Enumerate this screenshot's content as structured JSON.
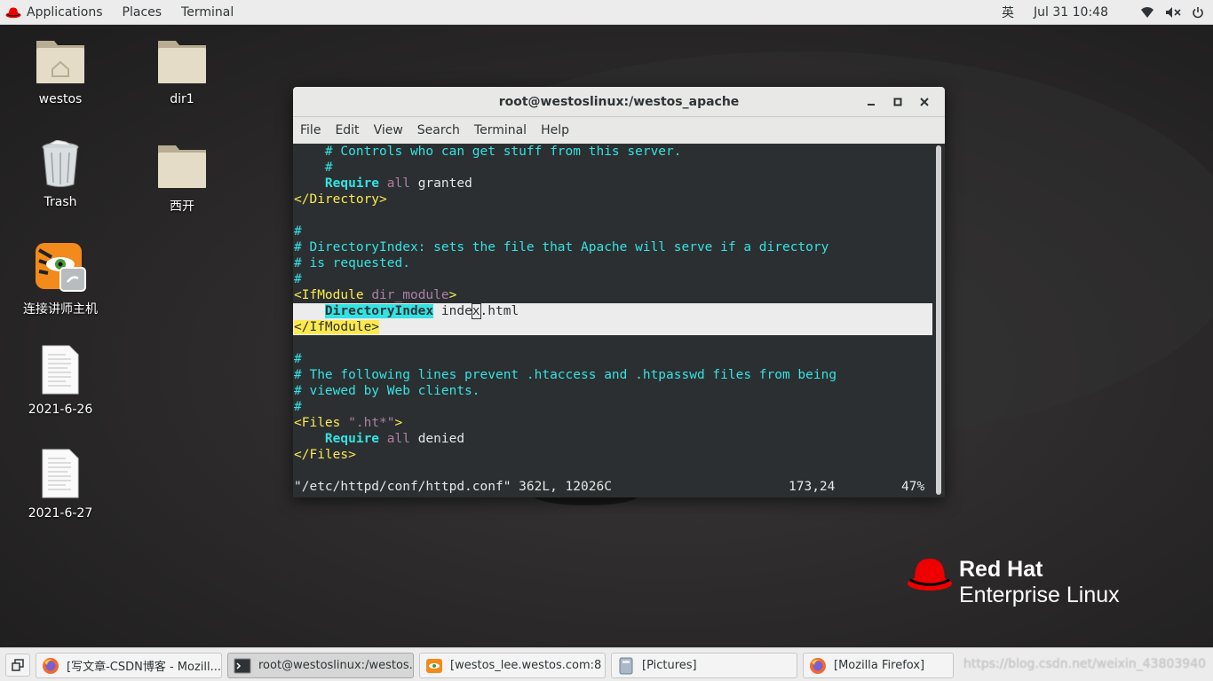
{
  "topbar": {
    "applications": "Applications",
    "places": "Places",
    "terminal": "Terminal",
    "input_method": "英",
    "clock": "Jul 31  10:48"
  },
  "desktop_icons": [
    {
      "label": "westos",
      "icon": "home-folder-icon"
    },
    {
      "label": "dir1",
      "icon": "folder-icon"
    },
    {
      "label": "Trash",
      "icon": "trash-icon"
    },
    {
      "label": "西开",
      "icon": "folder-icon"
    },
    {
      "label": "连接讲师主机",
      "icon": "remote-viewer-icon"
    },
    {
      "label": "2021-6-26",
      "icon": "document-icon"
    },
    {
      "label": "2021-6-27",
      "icon": "document-icon"
    }
  ],
  "terminal": {
    "title": "root@westoslinux:/westos_apache",
    "menu": [
      "File",
      "Edit",
      "View",
      "Search",
      "Terminal",
      "Help"
    ],
    "lines": {
      "l1": "    # Controls who can get stuff from this server.",
      "l2": "    #",
      "l3_kw": "Require",
      "l3_mid": "all",
      "l3_end": "granted",
      "l4": "</Directory>",
      "l6": "#",
      "l7": "# DirectoryIndex: sets the file that Apache will serve if a directory",
      "l8": "# is requested.",
      "l9": "#",
      "l10_tag": "<IfModule",
      "l10_attr": "dir_module",
      "l10_close": ">",
      "l11_kw": "DirectoryIndex",
      "l11_a": "inde",
      "l11_cursor": "x",
      "l11_b": ".html",
      "l12": "</IfModule>",
      "l14": "#",
      "l15": "# The following lines prevent .htaccess and .htpasswd files from being",
      "l16": "# viewed by Web clients.",
      "l17": "#",
      "l18_tag": "<Files",
      "l18_attr": "\".ht*\"",
      "l18_close": ">",
      "l19_kw": "Require",
      "l19_mid": "all",
      "l19_end": "denied",
      "l20": "</Files>"
    },
    "status_file": "\"/etc/httpd/conf/httpd.conf\" 362L, 12026C",
    "status_pos": "173,24",
    "status_pct": "47%"
  },
  "logo": {
    "line1": "Red Hat",
    "line2": "Enterprise Linux"
  },
  "taskbar": {
    "items": [
      {
        "label": "[写文章-CSDN博客 - Mozill...",
        "icon": "firefox-icon"
      },
      {
        "label": "root@westoslinux:/westos...",
        "icon": "terminal-icon"
      },
      {
        "label": "[westos_lee.westos.com:8 ...",
        "icon": "remote-viewer-icon"
      },
      {
        "label": "[Pictures]",
        "icon": "file-manager-icon"
      },
      {
        "label": "[Mozilla Firefox]",
        "icon": "firefox-icon"
      }
    ],
    "watermark": "https://blog.csdn.net/weixin_43803940"
  },
  "colors": {
    "comment": "#34e2e2",
    "keyword": "#34e2e2",
    "tag": "#fce94f",
    "attr": "#ad7fa8",
    "terminal_bg": "#2b2f31",
    "redhat_red": "#ee0000"
  }
}
